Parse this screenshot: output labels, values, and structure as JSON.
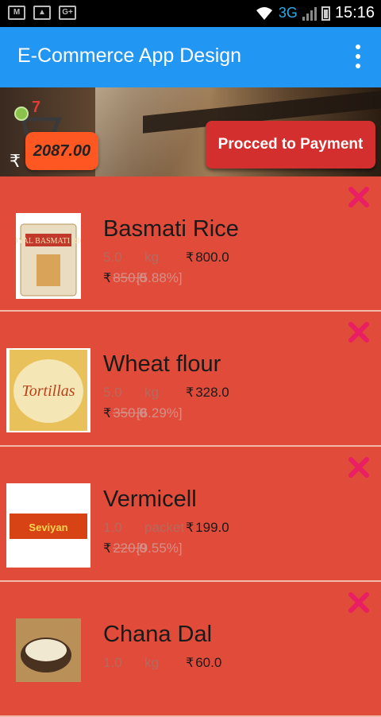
{
  "status_bar": {
    "time": "15:16",
    "network": "3G"
  },
  "app_bar": {
    "title": "E-Commerce App Design"
  },
  "banner": {
    "cart_count": "7",
    "currency": "₹",
    "total": "2087.00",
    "pay_button": "Procced to Payment"
  },
  "items": [
    {
      "name": "Basmati Rice",
      "qty": "5.0",
      "unit": "kg",
      "price": "800.0",
      "mrp": "850",
      "mrp_overlap": ".0",
      "discount": "[5.88%]",
      "image_label": "ROYAL BASMATI RICE"
    },
    {
      "name": "Wheat flour",
      "qty": "5.0",
      "unit": "kg",
      "price": "328.0",
      "mrp": "350",
      "mrp_overlap": ".0",
      "discount": "[6.29%]",
      "image_label": "Tortillas"
    },
    {
      "name": "Vermicell",
      "qty": "1.0",
      "unit": "packet",
      "price": "199.0",
      "mrp": "220",
      "mrp_overlap": ".0",
      "discount": "[9.55%]",
      "image_label": "Seviyan"
    },
    {
      "name": "Chana Dal",
      "qty": "1.0",
      "unit": "kg",
      "price": "60.0",
      "mrp": "",
      "mrp_overlap": "",
      "discount": "",
      "image_label": ""
    }
  ],
  "colors": {
    "app_bar": "#2196f3",
    "list_bg": "#e04b3a",
    "pay_button": "#d32f2f",
    "total_pill": "#ff5722",
    "remove_icon": "#e91e63"
  },
  "icons": [
    "mail-icon",
    "image-icon",
    "google-plus-icon",
    "wifi-icon",
    "signal-icon",
    "battery-icon",
    "overflow-menu-icon",
    "cart-icon",
    "remove-icon"
  ]
}
